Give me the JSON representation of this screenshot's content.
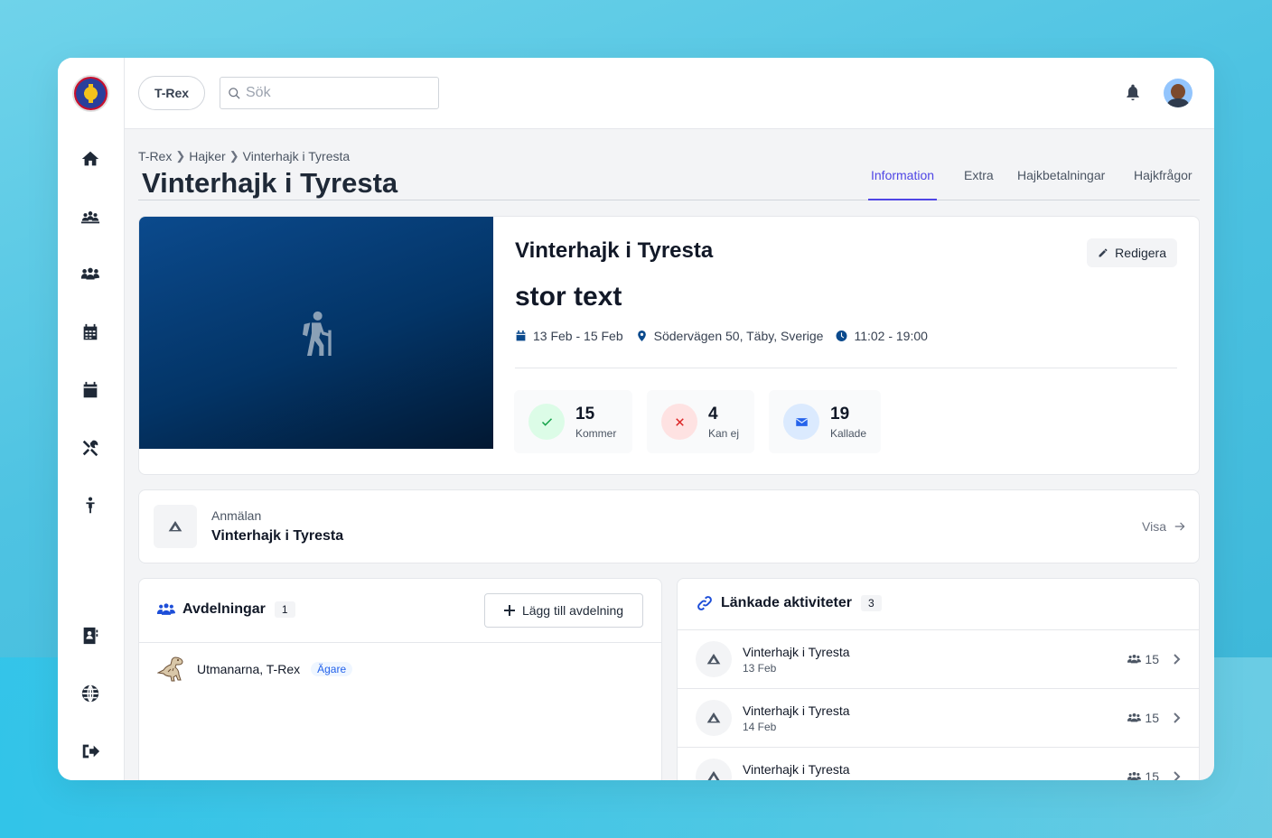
{
  "topbar": {
    "org": "T-Rex",
    "search_placeholder": "Sök"
  },
  "sidebar": {
    "items": [
      {
        "icon": "home-icon"
      },
      {
        "icon": "troop-icon"
      },
      {
        "icon": "members-icon"
      },
      {
        "icon": "calendar-grid-icon"
      },
      {
        "icon": "calendar-icon"
      },
      {
        "icon": "tools-icon"
      },
      {
        "icon": "child-icon"
      },
      {
        "icon": "contacts-icon"
      },
      {
        "icon": "globe-icon"
      },
      {
        "icon": "logout-icon"
      }
    ]
  },
  "breadcrumb": [
    "T-Rex",
    "Hajker",
    "Vinterhajk i Tyresta"
  ],
  "page_title": "Vinterhajk i Tyresta",
  "tabs": [
    "Information",
    "Extra",
    "Hajkbetalningar",
    "Hajkfrågor"
  ],
  "hero": {
    "title": "Vinterhajk i Tyresta",
    "subtitle": "stor text",
    "edit_label": "Redigera",
    "dates": "13 Feb - 15 Feb",
    "location": "Södervägen 50, Täby, Sverige",
    "time": "11:02 - 19:00",
    "stats": [
      {
        "value": "15",
        "label": "Kommer"
      },
      {
        "value": "4",
        "label": "Kan ej"
      },
      {
        "value": "19",
        "label": "Kallade"
      }
    ]
  },
  "anmalan": {
    "label": "Anmälan",
    "title": "Vinterhajk i Tyresta",
    "action": "Visa"
  },
  "departments": {
    "title": "Avdelningar",
    "count": "1",
    "add_label": "Lägg till avdelning",
    "items": [
      {
        "name": "Utmanarna, T-Rex",
        "badge": "Ägare"
      }
    ]
  },
  "linked": {
    "title": "Länkade aktiviteter",
    "count": "3",
    "items": [
      {
        "title": "Vinterhajk i Tyresta",
        "date": "13 Feb",
        "count": "15"
      },
      {
        "title": "Vinterhajk i Tyresta",
        "date": "14 Feb",
        "count": "15"
      },
      {
        "title": "Vinterhajk i Tyresta",
        "date": "",
        "count": "15"
      }
    ]
  },
  "colors": {
    "accent": "#4f46e5",
    "brand_blue": "#0b4a8d"
  }
}
